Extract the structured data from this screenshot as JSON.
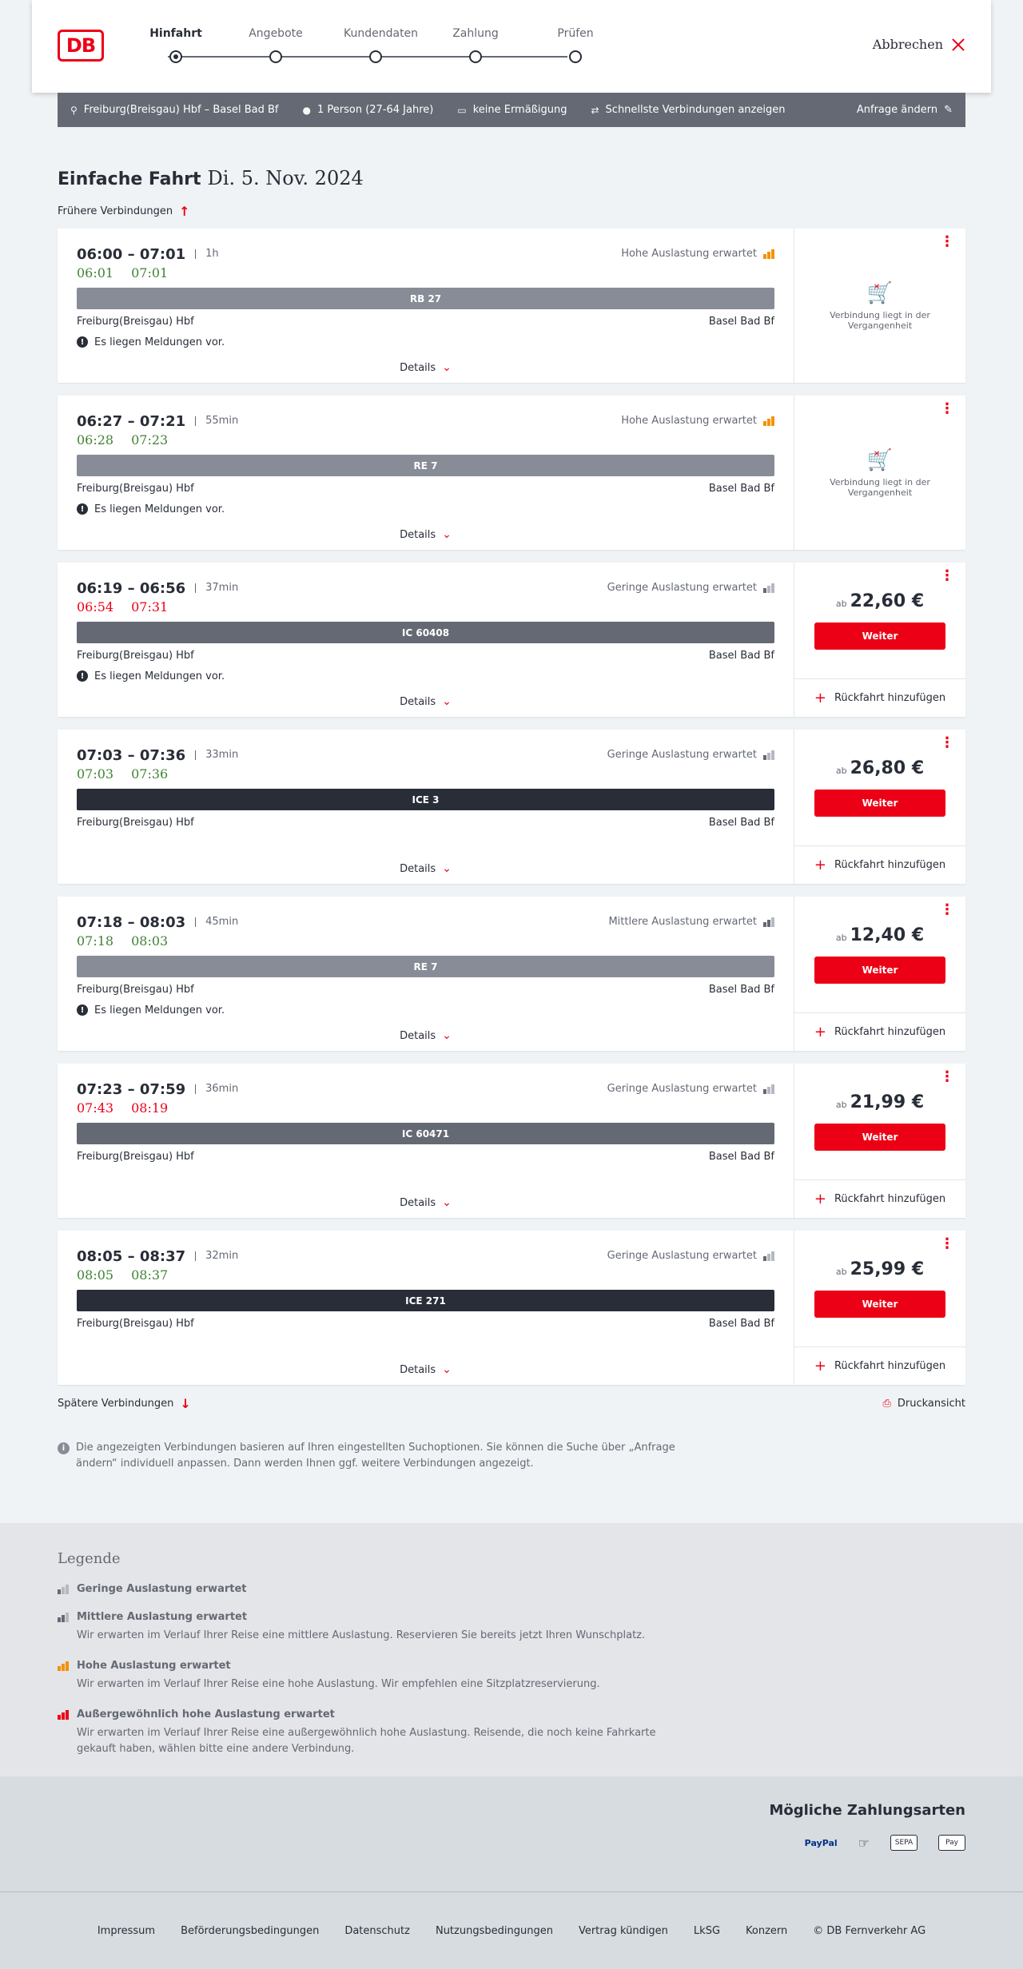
{
  "header": {
    "logo": "DB",
    "steps": [
      "Hinfahrt",
      "Angebote",
      "Kundendaten",
      "Zahlung",
      "Prüfen"
    ],
    "cancel": "Abbrechen"
  },
  "query": {
    "route": "Freiburg(Breisgau) Hbf – Basel Bad Bf",
    "persons": "1 Person (27-64 Jahre)",
    "discount": "keine Ermäßigung",
    "fastest": "Schnellste Verbindungen anzeigen",
    "change": "Anfrage ändern"
  },
  "title": {
    "type": "Einfache Fahrt",
    "date": "Di. 5. Nov. 2024"
  },
  "earlier": "Frühere Verbindungen",
  "later": "Spätere Verbindungen",
  "print": "Druckansicht",
  "details_label": "Details",
  "return_label": "Rückfahrt hinzufügen",
  "weiter_label": "Weiter",
  "ab_label": "ab",
  "past_label": "Verbindung liegt in der Vergangenheit",
  "messages_label": "Es liegen Meldungen vor.",
  "connections": [
    {
      "times": "06:00 – 07:01",
      "duration": "1h",
      "rt_dep": "06:01",
      "rt_arr": "07:01",
      "rt_dep_color": "green",
      "rt_arr_color": "green",
      "load": "Hohe Auslastung erwartet",
      "load_level": "high",
      "train": "RB 27",
      "train_type": "regio",
      "from": "Freiburg(Breisgau) Hbf",
      "to": "Basel Bad Bf",
      "messages": true,
      "past": true,
      "price": null
    },
    {
      "times": "06:27 – 07:21",
      "duration": "55min",
      "rt_dep": "06:28",
      "rt_arr": "07:23",
      "rt_dep_color": "green",
      "rt_arr_color": "green",
      "load": "Hohe Auslastung erwartet",
      "load_level": "high",
      "train": "RE 7",
      "train_type": "regio",
      "from": "Freiburg(Breisgau) Hbf",
      "to": "Basel Bad Bf",
      "messages": true,
      "past": true,
      "price": null
    },
    {
      "times": "06:19 – 06:56",
      "duration": "37min",
      "rt_dep": "06:54",
      "rt_arr": "07:31",
      "rt_dep_color": "red",
      "rt_arr_color": "red",
      "load": "Geringe Auslastung erwartet",
      "load_level": "low",
      "train": "IC 60408",
      "train_type": "ic",
      "from": "Freiburg(Breisgau) Hbf",
      "to": "Basel Bad Bf",
      "messages": true,
      "past": false,
      "price": "22,60 €"
    },
    {
      "times": "07:03 – 07:36",
      "duration": "33min",
      "rt_dep": "07:03",
      "rt_arr": "07:36",
      "rt_dep_color": "green",
      "rt_arr_color": "green",
      "load": "Geringe Auslastung erwartet",
      "load_level": "low",
      "train": "ICE 3",
      "train_type": "ice",
      "from": "Freiburg(Breisgau) Hbf",
      "to": "Basel Bad Bf",
      "messages": false,
      "past": false,
      "price": "26,80 €"
    },
    {
      "times": "07:18 – 08:03",
      "duration": "45min",
      "rt_dep": "07:18",
      "rt_arr": "08:03",
      "rt_dep_color": "green",
      "rt_arr_color": "green",
      "load": "Mittlere Auslastung erwartet",
      "load_level": "mid",
      "train": "RE 7",
      "train_type": "regio",
      "from": "Freiburg(Breisgau) Hbf",
      "to": "Basel Bad Bf",
      "messages": true,
      "past": false,
      "price": "12,40 €"
    },
    {
      "times": "07:23 – 07:59",
      "duration": "36min",
      "rt_dep": "07:43",
      "rt_arr": "08:19",
      "rt_dep_color": "red",
      "rt_arr_color": "red",
      "load": "Geringe Auslastung erwartet",
      "load_level": "low",
      "train": "IC 60471",
      "train_type": "ic",
      "from": "Freiburg(Breisgau) Hbf",
      "to": "Basel Bad Bf",
      "messages": false,
      "past": false,
      "price": "21,99 €"
    },
    {
      "times": "08:05 – 08:37",
      "duration": "32min",
      "rt_dep": "08:05",
      "rt_arr": "08:37",
      "rt_dep_color": "green",
      "rt_arr_color": "green",
      "load": "Geringe Auslastung erwartet",
      "load_level": "low",
      "train": "ICE 271",
      "train_type": "ice",
      "from": "Freiburg(Breisgau) Hbf",
      "to": "Basel Bad Bf",
      "messages": false,
      "past": false,
      "price": "25,99 €"
    }
  ],
  "info": "Die angezeigten Verbindungen basieren auf Ihren eingestellten Suchoptionen. Sie können die Suche über „Anfrage ändern“ individuell anpassen. Dann werden Ihnen ggf. weitere Verbindungen angezeigt.",
  "legend": {
    "title": "Legende",
    "items": [
      {
        "level": "low",
        "title": "Geringe Auslastung erwartet",
        "desc": ""
      },
      {
        "level": "mid",
        "title": "Mittlere Auslastung erwartet",
        "desc": "Wir erwarten im Verlauf Ihrer Reise eine mittlere Auslastung. Reservieren Sie bereits jetzt Ihren Wunschplatz."
      },
      {
        "level": "high",
        "title": "Hohe Auslastung erwartet",
        "desc": "Wir erwarten im Verlauf Ihrer Reise eine hohe Auslastung. Wir empfehlen eine Sitzplatzreservierung."
      },
      {
        "level": "vhigh",
        "title": "Außergewöhnlich hohe Auslastung erwartet",
        "desc": "Wir erwarten im Verlauf Ihrer Reise eine außergewöhnlich hohe Auslastung. Reisende, die noch keine Fahrkarte gekauft haben, wählen bitte eine andere Verbindung."
      }
    ]
  },
  "payments": {
    "title": "Mögliche Zahlungsarten",
    "methods": [
      "PayPal",
      "Kreditkarte",
      "SEPA",
      "Apple Pay"
    ],
    "paypal_text": "PayPal",
    "sepa_text": "SEPA",
    "applepay_text": "Pay"
  },
  "footer": [
    "Impressum",
    "Beförderungsbedingungen",
    "Datenschutz",
    "Nutzungsbedingungen",
    "Vertrag kündigen",
    "LkSG",
    "Konzern",
    "© DB Fernverkehr AG"
  ],
  "colors": {
    "db_red": "#ec0016",
    "on_time": "#408335",
    "delayed": "#ec0016",
    "high_load": "#f39200"
  }
}
